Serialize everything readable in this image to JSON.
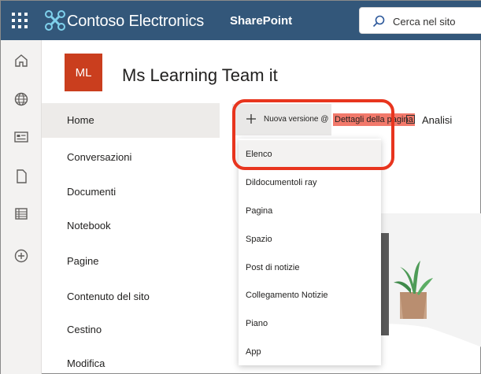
{
  "header": {
    "brand": "Contoso Electronics",
    "app": "SharePoint",
    "search_placeholder": "Cerca nel sito"
  },
  "rail": {
    "icons": [
      "home-icon",
      "globe-icon",
      "news-icon",
      "document-icon",
      "list-icon",
      "add-icon"
    ]
  },
  "site": {
    "logo_initials": "ML",
    "title": "Ms Learning Team it"
  },
  "nav": {
    "items": [
      {
        "label": "Home",
        "selected": true
      },
      {
        "label": "Conversazioni"
      },
      {
        "label": "Documenti"
      },
      {
        "label": "Notebook"
      },
      {
        "label": "Pagine"
      },
      {
        "label": "Contenuto del sito"
      },
      {
        "label": "Cestino"
      },
      {
        "label": "Modifica"
      }
    ]
  },
  "commandbar": {
    "new_label": "Nuova versione @",
    "details_label": "Dettagli della pagina",
    "analytics_label": "Analisi"
  },
  "dropdown": {
    "items": [
      {
        "label": "Elenco"
      },
      {
        "label": "Dildocumentoli ray"
      },
      {
        "label": "Pagina"
      },
      {
        "label": "Spazio"
      },
      {
        "label": "Post di notizie"
      },
      {
        "label": "Collegamento Notizie"
      },
      {
        "label": "Piano"
      },
      {
        "label": "App"
      }
    ]
  },
  "colors": {
    "topbar": "#33577a",
    "site_logo": "#ca3e1e",
    "highlight": "#e8351e",
    "details_bg": "#f2796b"
  }
}
